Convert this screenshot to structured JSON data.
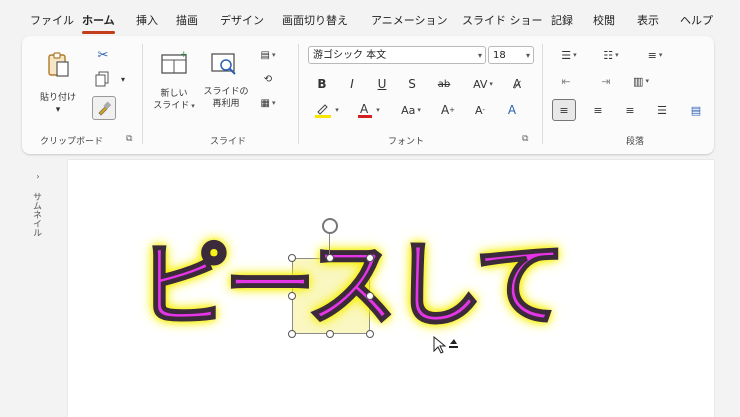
{
  "tabs": [
    "ファイル",
    "ホーム",
    "挿入",
    "描画",
    "デザイン",
    "画面切り替え",
    "アニメーション",
    "スライド ショー",
    "記録",
    "校閲",
    "表示",
    "ヘルプ"
  ],
  "active_tab": "ホーム",
  "ribbon": {
    "clipboard": {
      "paste_label": "貼り付け",
      "group_label": "クリップボード"
    },
    "slides": {
      "new_slide_label_1": "新しい",
      "new_slide_label_2": "スライド",
      "reuse_label_1": "スライドの",
      "reuse_label_2": "再利用",
      "group_label": "スライド"
    },
    "font": {
      "font_name": "游ゴシック 本文",
      "font_size": "18",
      "bold": "B",
      "italic": "I",
      "underline": "U",
      "strike": "S",
      "case_label": "Aa",
      "group_label": "フォント"
    },
    "paragraph": {
      "group_label": "段落"
    }
  },
  "thumbnail_pane_label": "サムネイル",
  "slide": {
    "text": "ピースして"
  },
  "colors": {
    "text_fill": "#e535e6",
    "text_glow": "#f6f000",
    "accent_tab": "#c43e1c"
  }
}
